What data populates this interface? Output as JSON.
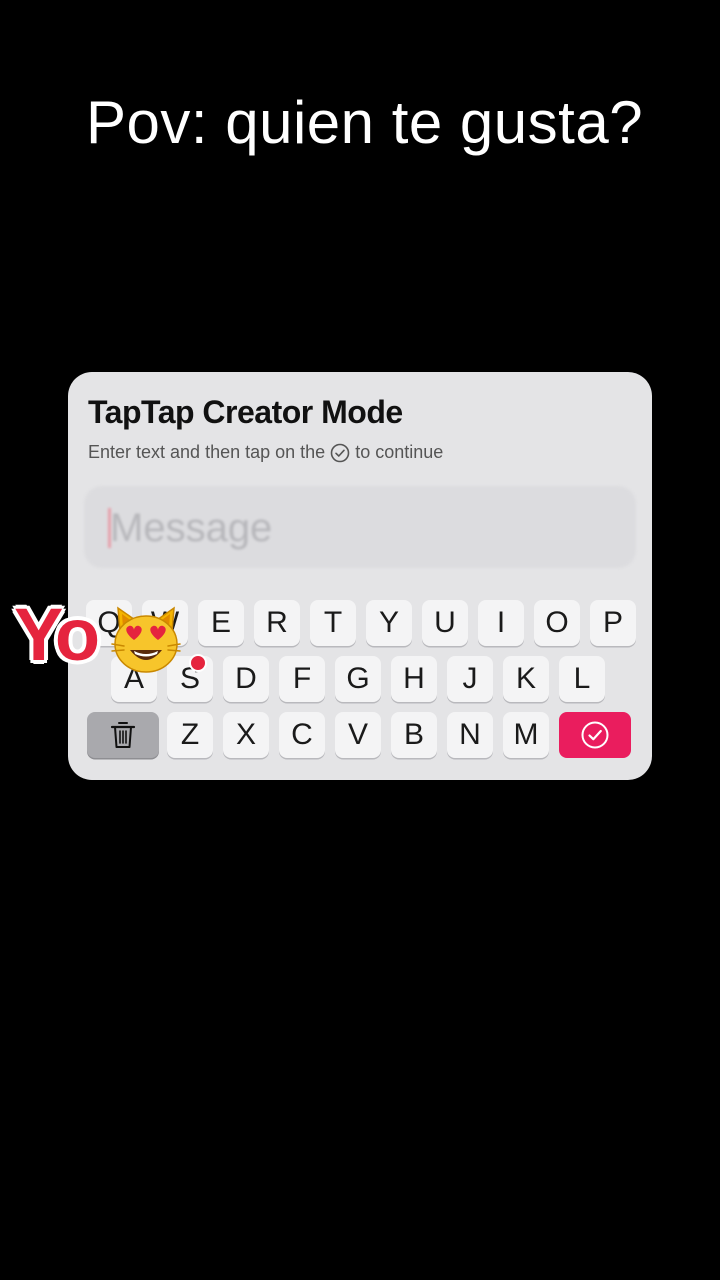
{
  "caption": {
    "text": "Pov: quien te gusta?"
  },
  "card": {
    "title": "TapTap Creator Mode",
    "subtitle_before": "Enter text and then tap on the",
    "subtitle_after": "to continue",
    "subtitle_icon": "check-circle-icon"
  },
  "message": {
    "placeholder": "Message"
  },
  "keyboard": {
    "row1": [
      "Q",
      "W",
      "E",
      "R",
      "T",
      "Y",
      "U",
      "I",
      "O",
      "P"
    ],
    "row2": [
      "A",
      "S",
      "D",
      "F",
      "G",
      "H",
      "J",
      "K",
      "L"
    ],
    "row3": [
      "Z",
      "X",
      "C",
      "V",
      "B",
      "N",
      "M"
    ],
    "delete_icon": "trash-icon",
    "submit_icon": "check-circle-icon"
  },
  "overlay": {
    "text": "Yo",
    "emoji_icon": "heart-eyes-cat-icon"
  },
  "colors": {
    "background": "#000000",
    "card": "#e4e4e6",
    "accent": "#ea1d5e",
    "overlay_text": "#e5243e"
  }
}
